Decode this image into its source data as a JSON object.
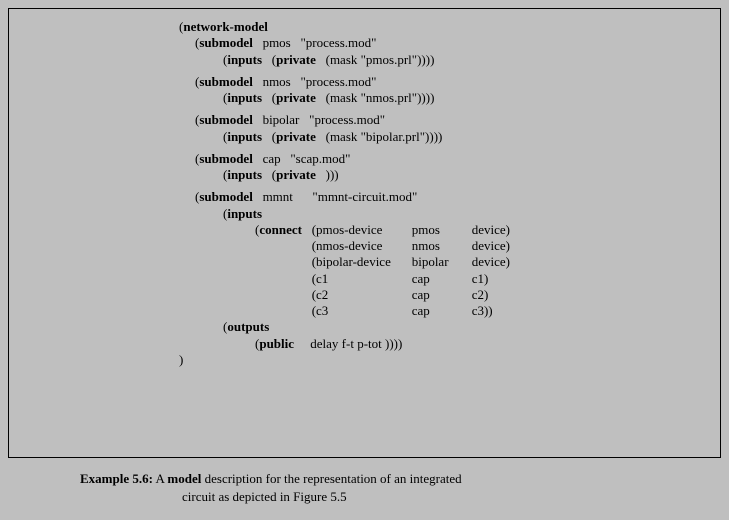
{
  "code": {
    "kw_network_model": "network-model",
    "kw_submodel": "submodel",
    "kw_inputs": "inputs",
    "kw_private": "private",
    "kw_connect": "connect",
    "kw_outputs": "outputs",
    "kw_public": "public",
    "pmos": {
      "name": "pmos",
      "file": "\"process.mod\"",
      "mask": "(mask   \"pmos.prl\"))))"
    },
    "nmos": {
      "name": "nmos",
      "file": "\"process.mod\"",
      "mask": "(mask \"nmos.prl\"))))"
    },
    "bipolar": {
      "name": "bipolar",
      "file": "\"process.mod\"",
      "mask": "(mask \"bipolar.prl\"))))"
    },
    "cap": {
      "name": "cap",
      "file": "\"scap.mod\"",
      "private_tail": ")))"
    },
    "mmnt": {
      "name": "mmnt",
      "file": "\"mmnt-circuit.mod\"",
      "connect_rows": [
        {
          "a": "(pmos-device",
          "b": "pmos",
          "c": "device)"
        },
        {
          "a": "(nmos-device",
          "b": "nmos",
          "c": "device)"
        },
        {
          "a": "(bipolar-device",
          "b": "bipolar",
          "c": "device)"
        },
        {
          "a": "(c1",
          "b": "cap",
          "c": "c1)"
        },
        {
          "a": "(c2",
          "b": "cap",
          "c": "c2)"
        },
        {
          "a": "(c3",
          "b": "cap",
          "c": "c3))"
        }
      ],
      "public_tail": "delay f-t p-tot ))))"
    },
    "close": ")"
  },
  "caption": {
    "label": "Example 5.6:",
    "pre": "A",
    "model_word": "model",
    "line1_rest": "description for the representation of an integrated",
    "line2": "circuit as depicted in Figure 5.5"
  }
}
